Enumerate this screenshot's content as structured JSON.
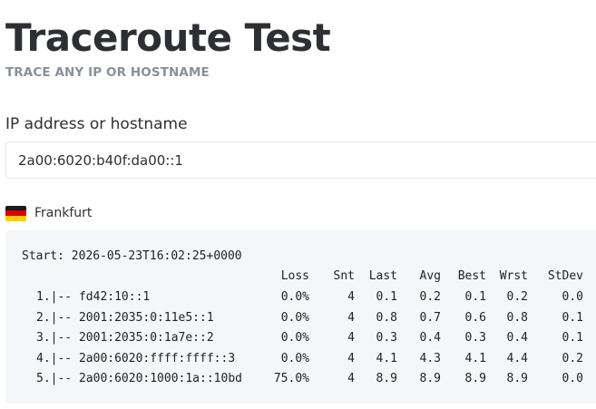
{
  "header": {
    "title": "Traceroute Test",
    "subtitle": "TRACE ANY IP OR HOSTNAME"
  },
  "form": {
    "label": "IP address or hostname",
    "value": "2a00:6020:b40f:da00::1"
  },
  "location": {
    "name": "Frankfurt",
    "flag_colors": [
      "#1a1a1a",
      "#dd0000",
      "#ffce00"
    ]
  },
  "result": {
    "start": "Start: 2026-05-23T16:02:25+0000",
    "columns": [
      "Loss",
      "Snt",
      "Last",
      "Avg",
      "Best",
      "Wrst",
      "StDev"
    ],
    "hops": [
      {
        "hop": "1.|-- fd42:10::1",
        "loss": "0.0%",
        "snt": "4",
        "last": "0.1",
        "avg": "0.2",
        "best": "0.1",
        "wrst": "0.2",
        "stdev": "0.0"
      },
      {
        "hop": "2.|-- 2001:2035:0:11e5::1",
        "loss": "0.0%",
        "snt": "4",
        "last": "0.8",
        "avg": "0.7",
        "best": "0.6",
        "wrst": "0.8",
        "stdev": "0.1"
      },
      {
        "hop": "3.|-- 2001:2035:0:1a7e::2",
        "loss": "0.0%",
        "snt": "4",
        "last": "0.3",
        "avg": "0.4",
        "best": "0.3",
        "wrst": "0.4",
        "stdev": "0.1"
      },
      {
        "hop": "4.|-- 2a00:6020:ffff:ffff::3",
        "loss": "0.0%",
        "snt": "4",
        "last": "4.1",
        "avg": "4.3",
        "best": "4.1",
        "wrst": "4.4",
        "stdev": "0.2"
      },
      {
        "hop": "5.|-- 2a00:6020:1000:1a::10bd",
        "loss": "75.0%",
        "snt": "4",
        "last": "8.9",
        "avg": "8.9",
        "best": "8.9",
        "wrst": "8.9",
        "stdev": "0.0"
      }
    ]
  }
}
